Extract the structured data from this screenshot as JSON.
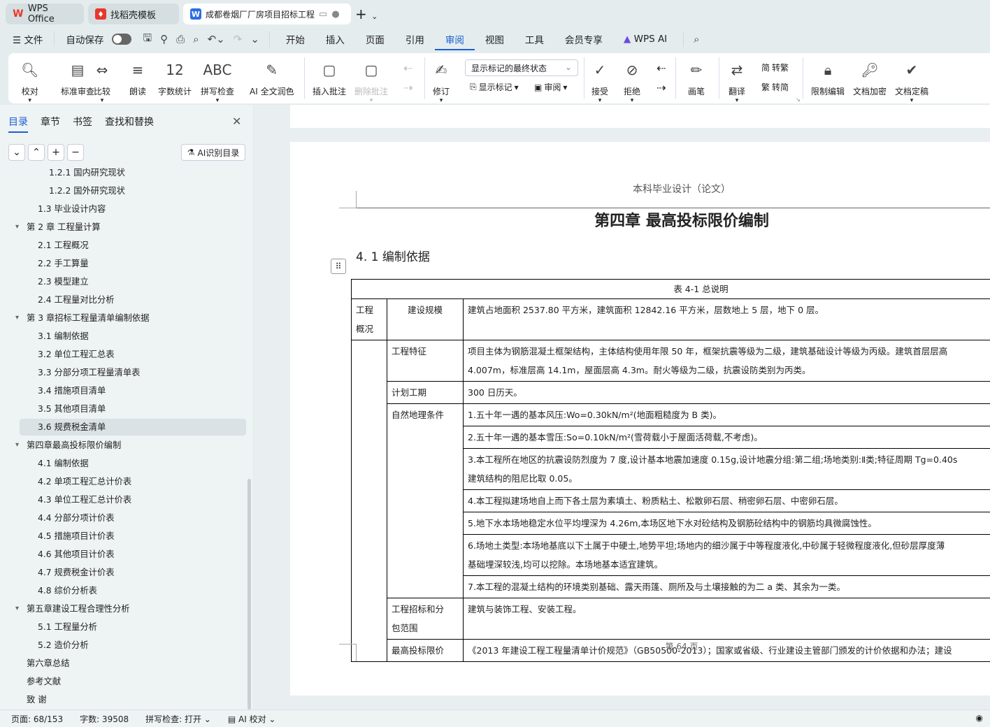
{
  "tabs": [
    {
      "label": "WPS Office",
      "icon": "wps-logo"
    },
    {
      "label": "找稻壳模板",
      "icon": "docer-logo"
    },
    {
      "label": "成都卷烟厂厂房项目招标工程",
      "icon": "word-doc-icon"
    }
  ],
  "menu": {
    "file": "文件",
    "autosave": "自动保存",
    "tabs": [
      "开始",
      "插入",
      "页面",
      "引用",
      "审阅",
      "视图",
      "工具",
      "会员专享",
      "WPS AI"
    ],
    "active": "审阅"
  },
  "ribbon": {
    "big": [
      {
        "label": "校对",
        "icon": "proofread-icon"
      },
      {
        "label": "标准审查",
        "icon": "standard-review-icon"
      },
      {
        "label": "比较",
        "icon": "compare-icon"
      },
      {
        "label": "朗读",
        "icon": "read-aloud-icon"
      },
      {
        "label": "字数统计",
        "icon": "word-count-icon"
      },
      {
        "label": "拼写检查",
        "icon": "spell-check-icon"
      },
      {
        "label": "AI 全文润色",
        "icon": "ai-polish-icon"
      },
      {
        "label": "插入批注",
        "icon": "insert-comment-icon"
      },
      {
        "label": "删除批注",
        "icon": "delete-comment-icon"
      },
      {
        "label": "修订",
        "icon": "track-changes-icon"
      },
      {
        "label": "接受",
        "icon": "accept-icon"
      },
      {
        "label": "拒绝",
        "icon": "reject-icon"
      },
      {
        "label": "画笔",
        "icon": "pen-icon"
      },
      {
        "label": "翻译",
        "icon": "translate-icon"
      },
      {
        "label": "限制编辑",
        "icon": "restrict-edit-icon"
      },
      {
        "label": "文档加密",
        "icon": "encrypt-icon"
      },
      {
        "label": "文档定稿",
        "icon": "finalize-icon"
      }
    ],
    "markup_select": "显示标记的最终状态",
    "show_markup": "显示标记",
    "review": "审阅",
    "to_traditional": "转繁",
    "to_simplified": "转简"
  },
  "sidebar": {
    "tabs": [
      "目录",
      "章节",
      "书签",
      "查找和替换"
    ],
    "ai_toc": "AI识别目录",
    "items": [
      {
        "label": "1.2.1 国内研究现状",
        "level": 2
      },
      {
        "label": "1.2.2 国外研究现状",
        "level": 2
      },
      {
        "label": "1.3 毕业设计内容",
        "level": 1
      },
      {
        "label": "第 2 章  工程量计算",
        "level": 0,
        "open": true
      },
      {
        "label": "2.1  工程概况",
        "level": 1
      },
      {
        "label": "2.2  手工算量",
        "level": 1
      },
      {
        "label": "2.3 模型建立",
        "level": 1
      },
      {
        "label": "2.4 工程量对比分析",
        "level": 1
      },
      {
        "label": "第 3 章招标工程量清单编制依据",
        "level": 0,
        "open": true
      },
      {
        "label": "3.1 编制依据",
        "level": 1
      },
      {
        "label": "3.2 单位工程汇总表",
        "level": 1
      },
      {
        "label": "3.3 分部分项工程量清单表",
        "level": 1
      },
      {
        "label": "3.4 措施项目清单",
        "level": 1
      },
      {
        "label": "3.5 其他项目清单",
        "level": 1
      },
      {
        "label": "3.6 规费税金清单",
        "level": 1,
        "selected": true
      },
      {
        "label": "第四章最高投标限价编制",
        "level": 0,
        "open": true
      },
      {
        "label": "4.1 编制依据",
        "level": 1
      },
      {
        "label": "4.2 单项工程汇总计价表",
        "level": 1
      },
      {
        "label": "4.3 单位工程汇总计价表",
        "level": 1
      },
      {
        "label": "4.4 分部分项计价表",
        "level": 1
      },
      {
        "label": "4.5 措施项目计价表",
        "level": 1
      },
      {
        "label": "4.6 其他项目计价表",
        "level": 1
      },
      {
        "label": "4.7 规费税金计价表",
        "level": 1
      },
      {
        "label": "4.8 综价分析表",
        "level": 1
      },
      {
        "label": "第五章建设工程合理性分析",
        "level": 0,
        "open": true
      },
      {
        "label": "5.1 工程量分析",
        "level": 1
      },
      {
        "label": "5.2 造价分析",
        "level": 1
      },
      {
        "label": "第六章总结",
        "level": 0
      },
      {
        "label": "参考文献",
        "level": 0
      },
      {
        "label": "致    谢",
        "level": 0
      }
    ]
  },
  "document": {
    "header": "本科毕业设计（论文）",
    "chapter": "第四章  最高投标限价编制",
    "section": "4. 1 编制依据",
    "table_caption": "表 4-1 总说明",
    "footer": "第  64  页",
    "rows": [
      {
        "c1": "工程\n概况",
        "c2": "建设规模",
        "c3": [
          "建筑占地面积 2537.80 平方米，建筑面积 12842.16 平方米，层数地上 5 层，地下 0 层。"
        ]
      },
      {
        "c2": "工程特征",
        "c3": [
          "项目主体为钢筋混凝土框架结构，主体结构使用年限 50 年，框架抗震等级为二级，建筑基础设计等级为丙级。建筑首层层高",
          "4.007m，标准层高 14.1m，屋面层高 4.3m。耐火等级为二级，抗震设防类别为丙类。"
        ]
      },
      {
        "c2": "计划工期",
        "c3": [
          "300 日历天。"
        ]
      },
      {
        "c2": "自然地理条件",
        "c3": [
          "1.五十年一遇的基本风压:Wo=0.30kN/m²(地面粗糙度为 B 类)。"
        ]
      },
      {
        "c3": [
          "2.五十年一遇的基本雪压:So=0.10kN/m²(雪荷载小于屋面活荷载,不考虑)。"
        ]
      },
      {
        "c3": [
          "3.本工程所在地区的抗震设防烈度为 7 度,设计基本地震加速度 0.15g,设计地震分组:第二组;场地类别:Ⅱ类;特征周期 Tg=0.40s",
          "建筑结构的阻尼比取 0.05。"
        ]
      },
      {
        "c3": [
          "4.本工程拟建场地自上而下各土层为素填土、粉质粘土、松散卵石层、稍密卵石层、中密卵石层。"
        ]
      },
      {
        "c3": [
          "5.地下水本场地稳定水位平均埋深为 4.26m,本场区地下水对砼结构及钢筋砼结构中的钢筋均具微腐蚀性。"
        ]
      },
      {
        "c3": [
          "6.场地土类型:本场地基底以下土属于中硬土,地势平坦;场地内的细沙属于中等程度液化,中砂属于轻微程度液化,但砂层厚度薄",
          "基础埋深较浅,均可以挖除。本场地基本适宜建筑。"
        ]
      },
      {
        "c3": [
          "7.本工程的混凝土结构的环境类别基础、露天雨篷、厕所及与土壤接触的为二 a 类、其余为一类。"
        ]
      },
      {
        "c2": "工程招标和分\n包范围",
        "c3": [
          "建筑与装饰工程、安装工程。"
        ]
      },
      {
        "c2": "最高投标限价",
        "c3": [
          "《2013 年建设工程工程量清单计价规范》（GB50500-2013）；国家或省级、行业建设主管部门颁发的计价依据和办法；建设"
        ]
      }
    ]
  },
  "status": {
    "page": "页面: 68/153",
    "words": "字数: 39508",
    "spell": "拼写检查: 打开",
    "ai_proof": "AI 校对"
  },
  "colors": {
    "accent": "#1b5fd3",
    "wps_red": "#e8372c",
    "doc_blue": "#2b6fe0"
  }
}
